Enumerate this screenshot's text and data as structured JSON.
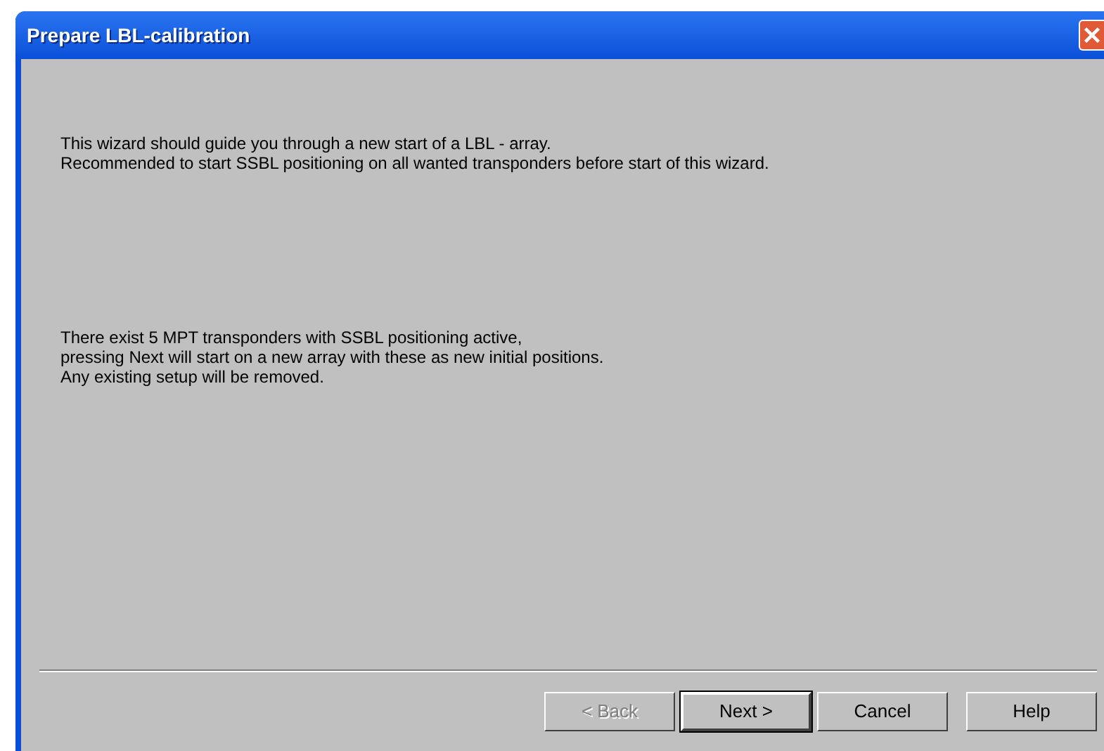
{
  "window": {
    "title": "Prepare LBL-calibration"
  },
  "paragraphs": [
    "This wizard should guide you through a new start of a LBL - array.\nRecommended to start SSBL positioning on all wanted transponders before start of this wizard.",
    "There exist 5 MPT transponders with SSBL positioning active,\npressing Next will start on a new array with these as new initial positions.\nAny existing setup will be removed."
  ],
  "buttons": [
    {
      "label": "< Back",
      "disabled": true,
      "default": false
    },
    {
      "label": "Next >",
      "disabled": false,
      "default": true
    },
    {
      "label": "Cancel",
      "disabled": false,
      "default": false
    },
    {
      "label": "Help",
      "disabled": false,
      "default": false
    }
  ]
}
